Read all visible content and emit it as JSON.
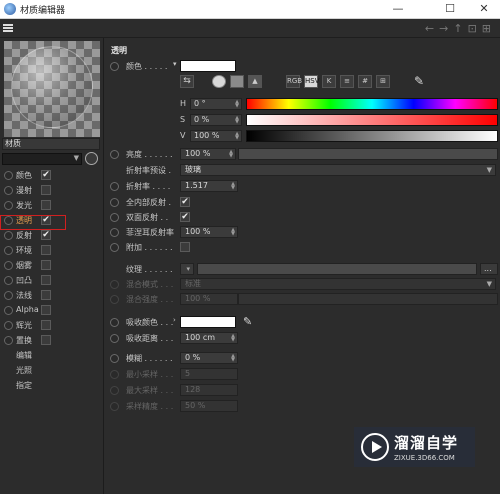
{
  "window": {
    "title": "材质编辑器",
    "minimize": "—",
    "maximize": "☐",
    "close": "✕"
  },
  "preview": {
    "material_name": "材质"
  },
  "channels": [
    {
      "label": "颜色",
      "checked": "✔"
    },
    {
      "label": "漫射",
      "checked": ""
    },
    {
      "label": "发光",
      "checked": ""
    },
    {
      "label": "透明",
      "checked": "✔"
    },
    {
      "label": "反射",
      "checked": "✔"
    },
    {
      "label": "环境",
      "checked": ""
    },
    {
      "label": "烟雾",
      "checked": ""
    },
    {
      "label": "凹凸",
      "checked": ""
    },
    {
      "label": "法线",
      "checked": ""
    },
    {
      "label": "Alpha",
      "checked": ""
    },
    {
      "label": "辉光",
      "checked": ""
    },
    {
      "label": "置换",
      "checked": ""
    }
  ],
  "extra_items": [
    "编辑",
    "光照",
    "指定"
  ],
  "section": {
    "title": "透明"
  },
  "color": {
    "label": "颜色 . . . . .",
    "swatch": "#ffffff",
    "modes": [
      "RGB",
      "HSV",
      "K"
    ],
    "h": {
      "label": "H",
      "value": "0 °"
    },
    "s": {
      "label": "S",
      "value": "0 %"
    },
    "v": {
      "label": "V",
      "value": "100 %"
    }
  },
  "params": {
    "brightness": {
      "label": "亮度 . . . . . .",
      "value": "100 %",
      "fill": 1.0
    },
    "ior_preset": {
      "label": "折射率预设 .",
      "value": "玻璃"
    },
    "ior": {
      "label": "折射率 . . . .",
      "value": "1.517"
    },
    "total_internal": {
      "label": "全内部反射 .",
      "checked": "✔"
    },
    "double_reflect": {
      "label": "双面反射 . .",
      "checked": "✔"
    },
    "fresnel": {
      "label": "菲涅耳反射率",
      "value": "100 %",
      "fill": 1.0
    },
    "additive": {
      "label": "附加 . . . . . .",
      "checked": ""
    },
    "texture": {
      "label": "纹理 . . . . . .",
      "button": "..."
    },
    "mix_mode": {
      "label": "混合模式 . . .",
      "value": "标准"
    },
    "mix_strength": {
      "label": "混合强度 . . .",
      "value": "100 %"
    },
    "absorb_color": {
      "label": "吸收颜色 . . .",
      "swatch": "#ffffff"
    },
    "absorb_dist": {
      "label": "吸收距离 . . .",
      "value": "100 cm"
    },
    "blur": {
      "label": "模糊 . . . . . .",
      "value": "0 %"
    },
    "min_samples": {
      "label": "最小采样 . . .",
      "value": "5"
    },
    "max_samples": {
      "label": "最大采样 . . .",
      "value": "128"
    },
    "accuracy": {
      "label": "采样精度 . . .",
      "value": "50 %"
    }
  },
  "watermark": {
    "title": "溜溜自学",
    "url": "ZIXUE.3D66.COM"
  }
}
